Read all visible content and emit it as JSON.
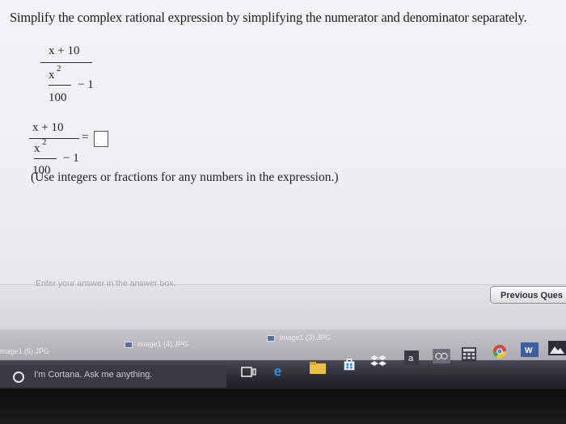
{
  "problem": {
    "prompt": "Simplify the complex rational expression by simplifying the numerator and denominator separately.",
    "expr_numerator": "x + 10",
    "expr_x": "x",
    "expr_exponent": "2",
    "expr_minus_one": "− 1",
    "expr_denominator": "100",
    "equals": "=",
    "instruction": "(Use integers or fractions for any numbers in the expression.)",
    "answer_hint": "Enter your answer in the answer box."
  },
  "nav": {
    "previous_label": "Previous Ques"
  },
  "files": [
    "mage1 (5).JPG",
    "image1 (4).JPG",
    "image1 (3).JPG"
  ],
  "taskbar": {
    "cortana_text": "I'm Cortana. Ask me anything.",
    "apps": [
      "task-view-icon",
      "edge-icon",
      "file-explorer-icon",
      "store-icon",
      "dropbox-icon",
      "amazon-icon",
      "app-icon",
      "calculator-icon",
      "chrome-icon",
      "word-icon",
      "photos-icon"
    ]
  }
}
